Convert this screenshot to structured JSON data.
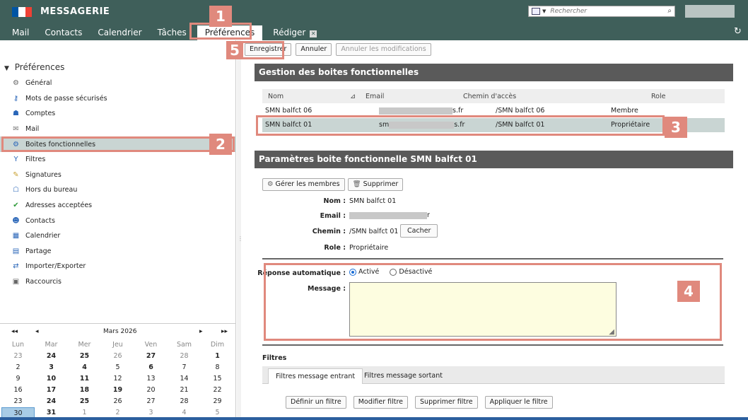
{
  "header": {
    "app_title": "MESSAGERIE",
    "search_placeholder": "Rechercher",
    "flag_colors": [
      "#0055a4",
      "#ffffff",
      "#ef4135"
    ]
  },
  "tabs": [
    {
      "label": "Mail"
    },
    {
      "label": "Contacts"
    },
    {
      "label": "Calendrier"
    },
    {
      "label": "Tâches"
    },
    {
      "label": "Préférences",
      "active": true
    },
    {
      "label": "Rédiger"
    }
  ],
  "toolbar": {
    "save": "Enregistrer",
    "cancel": "Annuler",
    "undo": "Annuler les modifications"
  },
  "sidebar": {
    "title": "Préférences",
    "items": [
      {
        "label": "Général",
        "icon": "gear-icon"
      },
      {
        "label": "Mots de passe sécurisés",
        "icon": "keys-icon"
      },
      {
        "label": "Comptes",
        "icon": "accounts-icon"
      },
      {
        "label": "Mail",
        "icon": "mail-icon"
      },
      {
        "label": "Boites fonctionnelles",
        "icon": "shared-box-icon",
        "selected": true
      },
      {
        "label": "Filtres",
        "icon": "filter-icon"
      },
      {
        "label": "Signatures",
        "icon": "signature-icon"
      },
      {
        "label": "Hors du bureau",
        "icon": "out-of-office-icon"
      },
      {
        "label": "Adresses acceptées",
        "icon": "shield-check-icon"
      },
      {
        "label": "Contacts",
        "icon": "contacts-icon"
      },
      {
        "label": "Calendrier",
        "icon": "calendar-icon"
      },
      {
        "label": "Partage",
        "icon": "share-icon"
      },
      {
        "label": "Importer/Exporter",
        "icon": "import-export-icon"
      },
      {
        "label": "Raccourcis",
        "icon": "shortcut-icon"
      }
    ]
  },
  "calendar": {
    "month": "Mars 2026",
    "weekdays": [
      "Lun",
      "Mar",
      "Mer",
      "Jeu",
      "Ven",
      "Sam",
      "Dim"
    ],
    "weeks": [
      [
        "23",
        "24",
        "25",
        "26",
        "27",
        "28",
        "1"
      ],
      [
        "2",
        "3",
        "4",
        "5",
        "6",
        "7",
        "8"
      ],
      [
        "9",
        "10",
        "11",
        "12",
        "13",
        "14",
        "15"
      ],
      [
        "16",
        "17",
        "18",
        "19",
        "20",
        "21",
        "22"
      ],
      [
        "23",
        "24",
        "25",
        "26",
        "27",
        "28",
        "29"
      ],
      [
        "30",
        "31",
        "1",
        "2",
        "3",
        "4",
        "5"
      ]
    ]
  },
  "boxes": {
    "title": "Gestion des boites fonctionnelles",
    "columns": [
      "Nom",
      "Email",
      "Chemin d'accès",
      "Role"
    ],
    "rows": [
      {
        "name": "SMN balfct 06",
        "email_suffix": "s.fr",
        "path": "/SMN balfct 06",
        "role": "Membre"
      },
      {
        "name": "SMN balfct 01",
        "email_prefix": "sm",
        "email_suffix": "s.fr",
        "path": "/SMN balfct 01",
        "role": "Propriétaire"
      }
    ]
  },
  "params": {
    "title": "Paramètres boite fonctionnelle SMN balfct 01",
    "manage_members": "Gérer les membres",
    "delete": "Supprimer",
    "name_label": "Nom :",
    "name_value": "SMN balfct 01",
    "email_label": "Email :",
    "email_suffix": "r",
    "path_label": "Chemin :",
    "path_value": "/SMN balfct 01",
    "hide": "Cacher",
    "role_label": "Role :",
    "role_value": "Propriétaire",
    "auto_reply_label": "Réponse automatique :",
    "active": "Activé",
    "inactive": "Désactivé",
    "message_label": "Message :"
  },
  "filters": {
    "title": "Filtres",
    "tab_in": "Filtres message entrant",
    "tab_out": "Filtres message sortant",
    "define": "Définir un filtre",
    "modify": "Modifier filtre",
    "delete": "Supprimer filtre",
    "apply": "Appliquer le filtre"
  },
  "callouts": [
    "1",
    "2",
    "3",
    "4",
    "5"
  ]
}
